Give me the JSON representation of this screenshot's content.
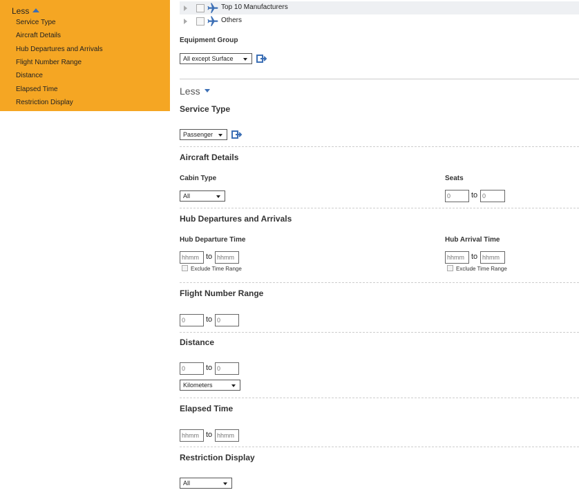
{
  "sidebar": {
    "less_label": "Less",
    "links": [
      "Service Type",
      "Aircraft Details",
      "Hub Departures and Arrivals",
      "Flight Number Range",
      "Distance",
      "Elapsed Time",
      "Restriction Display"
    ]
  },
  "tree": [
    {
      "label": "Top 10 Manufacturers"
    },
    {
      "label": "Others"
    }
  ],
  "equipment_group": {
    "label": "Equipment Group",
    "value": "All except Surface"
  },
  "less_label": "Less",
  "service_type": {
    "heading": "Service Type",
    "value": "Passenger"
  },
  "aircraft_details": {
    "heading": "Aircraft Details",
    "cabin_type": {
      "label": "Cabin Type",
      "value": "All"
    },
    "seats": {
      "label": "Seats",
      "from_placeholder": "0",
      "to_placeholder": "0"
    }
  },
  "hub": {
    "heading": "Hub Departures and Arrivals",
    "departure": {
      "label": "Hub Departure Time",
      "from_placeholder": "hhmm",
      "to_placeholder": "hhmm",
      "exclude_label": "Exclude Time Range"
    },
    "arrival": {
      "label": "Hub Arrival Time",
      "from_placeholder": "hhmm",
      "to_placeholder": "hhmm",
      "exclude_label": "Exclude Time Range"
    }
  },
  "flight_number_range": {
    "heading": "Flight Number Range",
    "from_placeholder": "0",
    "to_placeholder": "0"
  },
  "distance": {
    "heading": "Distance",
    "from_placeholder": "0",
    "to_placeholder": "0",
    "unit": "Kilometers"
  },
  "elapsed_time": {
    "heading": "Elapsed Time",
    "from_placeholder": "hhmm",
    "to_placeholder": "hhmm"
  },
  "restriction_display": {
    "heading": "Restriction Display",
    "value": "All"
  },
  "to_label": "to",
  "colors": {
    "sidebar_bg": "#f5a623",
    "accent": "#3c6fb5"
  }
}
